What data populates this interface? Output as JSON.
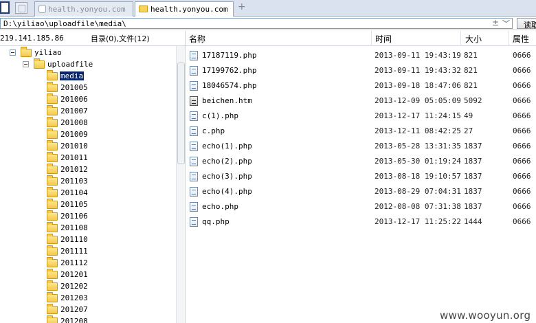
{
  "tabs": [
    {
      "label": "health.yonyou.com",
      "active": false
    },
    {
      "label": "health.yonyou.com",
      "active": true
    }
  ],
  "address": {
    "path": "D:\\yiliao\\uploadfile\\media\\",
    "go_label": "读取"
  },
  "header": {
    "ip": "219.141.185.86",
    "count": "目录(0),文件(12)",
    "col_name": "名称",
    "col_time": "时间",
    "col_size": "大小",
    "col_attr": "属性"
  },
  "tree": {
    "root": "yiliao",
    "child": "uploadfile",
    "folders": [
      "media",
      "201005",
      "201006",
      "201007",
      "201008",
      "201009",
      "201010",
      "201011",
      "201012",
      "201103",
      "201104",
      "201105",
      "201106",
      "201108",
      "201110",
      "201111",
      "201112",
      "201201",
      "201202",
      "201203",
      "201207",
      "201208"
    ]
  },
  "files": [
    {
      "name": "17187119.php",
      "time": "2013-09-11 19:43:19",
      "size": "821",
      "attr": "0666",
      "icon": "php-file-icon"
    },
    {
      "name": "17199762.php",
      "time": "2013-09-11 19:43:32",
      "size": "821",
      "attr": "0666",
      "icon": "php-file-icon"
    },
    {
      "name": "18046574.php",
      "time": "2013-09-18 18:47:06",
      "size": "821",
      "attr": "0666",
      "icon": "php-file-icon"
    },
    {
      "name": "beichen.htm",
      "time": "2013-12-09 05:05:09",
      "size": "5092",
      "attr": "0666",
      "icon": "html-file-icon"
    },
    {
      "name": "c(1).php",
      "time": "2013-12-17 11:24:15",
      "size": "49",
      "attr": "0666",
      "icon": "php-file-icon"
    },
    {
      "name": "c.php",
      "time": "2013-12-11 08:42:25",
      "size": "27",
      "attr": "0666",
      "icon": "php-file-icon"
    },
    {
      "name": "echo(1).php",
      "time": "2013-05-28 13:31:35",
      "size": "1837",
      "attr": "0666",
      "icon": "php-file-icon"
    },
    {
      "name": "echo(2).php",
      "time": "2013-05-30 01:19:24",
      "size": "1837",
      "attr": "0666",
      "icon": "php-file-icon"
    },
    {
      "name": "echo(3).php",
      "time": "2013-08-18 19:10:57",
      "size": "1837",
      "attr": "0666",
      "icon": "php-file-icon"
    },
    {
      "name": "echo(4).php",
      "time": "2013-08-29 07:04:31",
      "size": "1837",
      "attr": "0666",
      "icon": "php-file-icon"
    },
    {
      "name": "echo.php",
      "time": "2012-08-08 07:31:38",
      "size": "1837",
      "attr": "0666",
      "icon": "php-file-icon"
    },
    {
      "name": "qq.php",
      "time": "2013-12-17 11:25:22",
      "size": "1444",
      "attr": "0666",
      "icon": "php-file-icon"
    }
  ],
  "watermark": "www.wooyun.org"
}
